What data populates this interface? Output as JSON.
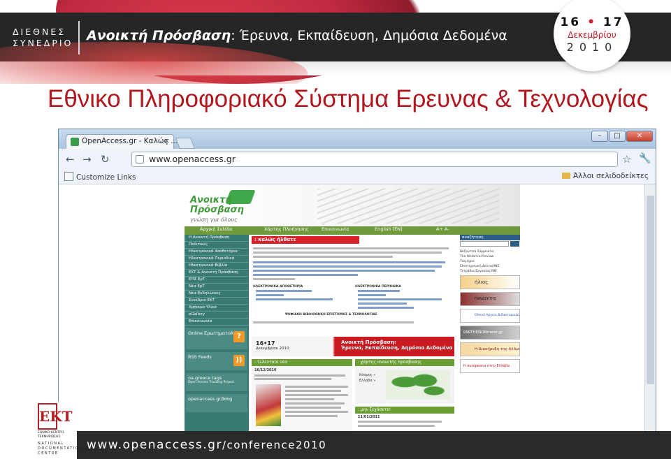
{
  "slide": {
    "conference_name": [
      "ΔΙΕΘΝΕΣ",
      "ΣΥΝΕΔΡΙΟ"
    ],
    "title_bold": "Ανοικτή Πρόσβαση",
    "title_rest": ": Έρευνα, Εκπαίδευση, Δημόσια Δεδομένα",
    "date": {
      "day_start": "16",
      "day_end": "17",
      "month": "Δεκεμβρίου",
      "year": "2010"
    },
    "heading": "Εθνικο Πληροφοριακό Σύστημα Ερευνας & Τεχνολογίας",
    "footer_url": "www.openaccess.gr",
    "footer_path": "/conference2010",
    "footer_logo_letters": "ΕΚΤ",
    "footer_logo_lines": [
      "ΕΘΝΙΚΟ ΚΕΝΤΡΟ",
      "ΤΕΚΜΗΡΙΩΣΗΣ"
    ],
    "footer_logo_lines_en": [
      "NATIONAL",
      "DOCUMENTATION",
      "CENTRE"
    ]
  },
  "browser": {
    "tab_title": "OpenAccess.gr - Καλώς ...",
    "tab_close": "×",
    "new_tab": "",
    "address": "www.openaccess.gr",
    "bookmark_left": "Customize Links",
    "bookmark_right": "Άλλοι σελιδοδείκτες",
    "window_controls": [
      "–",
      "□",
      "✕"
    ]
  },
  "site": {
    "logo_line1": "Ανοικτή",
    "logo_line2": "Πρόσβαση",
    "logo_tagline": "γνώση για όλους",
    "nav": [
      "Αρχική Σελίδα",
      "Χάρτης Πλοήγησης",
      "Επικοινωνία",
      "English [EN]",
      "A+ A-"
    ],
    "side_menu": [
      "Η Ανοικτή Πρόσβαση",
      "Πολιτικές",
      "Ηλεκτρονικά Αποθετήρια",
      "Ηλεκτρονικά Περιοδικά",
      "Ηλεκτρονικά Βιβλία",
      "ΕΚΤ & Ανοικτή Πρόσβαση",
      "ΕΠΣ ΕρΤ",
      "Νέα ΕρΤ",
      "Νέα-Εκδηλώσεις",
      "Συνέδριο ΕΚΤ",
      "Χρήσιμο Υλικό",
      "eGallery",
      "Επικοινωνία"
    ],
    "side_boxes": [
      "Online Ερωτηματολόγιο",
      "RSS Feeds",
      "oa.greece tags",
      "openaccess.gr/blog"
    ],
    "side_box_sub": "Open Access Tracking Project",
    "welcome": ": καλώς ήλθατε",
    "section_repos": "ΗΛΕΚΤΡΟΝΙΚΑ ΑΠΟΘΕΤΗΡΙΑ",
    "section_journals": "ΗΛΕΚΤΡΟΝΙΚΑ ΠΕΡΙΟΔΙΚΑ",
    "section_portal": "ΨΗΦΙΑΚΗ ΒΙΒΛΙΟΘΗΚΗ ΕΠΙΣΤΗΜΗΣ & ΤΕΧΝΟΛΟΓΙΑΣ",
    "banner_date": "16•17",
    "banner_month": "Δεκεμβρίου 2010",
    "banner_text1": "Ανοικτή Πρόσβαση:",
    "banner_text2": "Έρευνα, Εκπαίδευση, Δημόσια Δεδομένα",
    "news_title": ": τελευταία νέα",
    "news_date": "16/12/2010",
    "map_title": ": χάρτης ανοικτής πρόσβασης",
    "map_labels": [
      "Κόσμος »",
      "Ελλάδα »"
    ],
    "dont_forget": ": μην ξεχάσετε!",
    "dont_forget_date": "11/01/2011",
    "search_label": "αναζήτηση",
    "right_links": [
      "Βυζαντινά Σύμμεικτα",
      "The Historical Review",
      "Τεκμήριο",
      "Επιστημονική Δελτίο/ΙΝΕ",
      "Τετράδια Εργασίας/ΙΝΕ"
    ],
    "right_buttons": [
      "ήλιος",
      "ΠΑΝΔΕΚΤΗΣ",
      "Εθνικό Αρχείο Διδακτορικών",
      "PARTHENONmeze.gr",
      "Η Διακήρυξη της Αλάμπρα",
      "H europeana στην Ελλάδα"
    ]
  },
  "colors": {
    "brand_red": "#b0171f",
    "header_dark": "#262626",
    "site_green": "#6f9a3c",
    "site_teal": "#3a7a74"
  },
  "icons": [
    "back-arrow-icon",
    "forward-arrow-icon",
    "reload-icon",
    "page-icon",
    "star-icon",
    "wrench-icon",
    "folder-icon"
  ]
}
